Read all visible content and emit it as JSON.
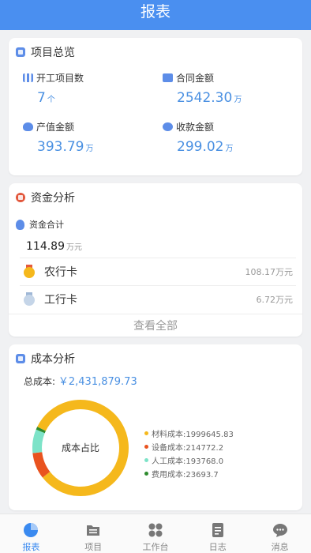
{
  "header": {
    "title": "报表"
  },
  "overview": {
    "title": "项目总览",
    "items": [
      {
        "label": "开工项目数",
        "value": "7",
        "unit": "个"
      },
      {
        "label": "合同金额",
        "value": "2542.30",
        "unit": "万"
      },
      {
        "label": "产值金额",
        "value": "393.79",
        "unit": "万"
      },
      {
        "label": "收款金额",
        "value": "299.02",
        "unit": "万"
      }
    ]
  },
  "fund": {
    "title": "资金分析",
    "total_label": "资金合计",
    "total_value": "114.89",
    "total_unit": "万元",
    "banks": [
      {
        "name": "农行卡",
        "amount": "108.17万元"
      },
      {
        "name": "工行卡",
        "amount": "6.72万元"
      }
    ],
    "view_all": "查看全部"
  },
  "cost": {
    "title": "成本分析",
    "total_label": "总成本:",
    "total_value": "￥2,431,879.73",
    "center_label": "成本占比",
    "legend": [
      {
        "label": "材料成本:1999645.83",
        "value": 1999645.83,
        "color": "#f5b81c"
      },
      {
        "label": "设备成本:214772.2",
        "value": 214772.2,
        "color": "#e9531f"
      },
      {
        "label": "人工成本:193768.0",
        "value": 193768.0,
        "color": "#7de3c8"
      },
      {
        "label": "费用成本:23693.7",
        "value": 23693.7,
        "color": "#2e8b2e"
      }
    ]
  },
  "tabbar": {
    "tabs": [
      {
        "label": "报表"
      },
      {
        "label": "项目"
      },
      {
        "label": "工作台"
      },
      {
        "label": "日志"
      },
      {
        "label": "消息"
      }
    ]
  }
}
